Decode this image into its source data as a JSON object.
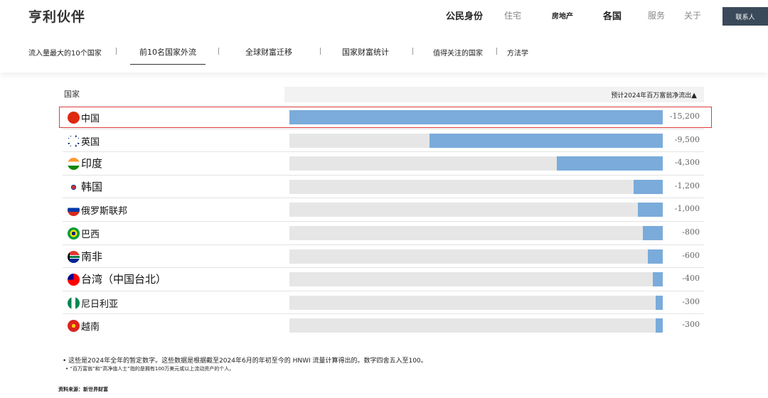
{
  "brand": "亨利伙伴",
  "nav": [
    {
      "label": "公民身份"
    },
    {
      "label": "住宅"
    },
    {
      "label": "房地产"
    },
    {
      "label": "各国"
    },
    {
      "label": "服务"
    },
    {
      "label": "关于"
    }
  ],
  "contact_label": "联系人",
  "subnav": [
    {
      "label": "流入量最大的10个国家"
    },
    {
      "label": "前10名国家外流"
    },
    {
      "label": "全球财富迁移"
    },
    {
      "label": "国家财富统计"
    },
    {
      "label": "值得关注的国家"
    },
    {
      "label": "方法学"
    }
  ],
  "table": {
    "country_header": "国家",
    "metric_header": "预计2024年百万富翁净流出",
    "sort_icon": "▲"
  },
  "chart_data": {
    "type": "bar",
    "orientation": "horizontal",
    "categories": [
      "中国",
      "英国",
      "印度",
      "韩国",
      "俄罗斯联邦",
      "巴西",
      "南非",
      "台湾（中国台北）",
      "尼日利亚",
      "越南"
    ],
    "values": [
      -15200,
      -9500,
      -4300,
      -1200,
      -1000,
      -800,
      -600,
      -400,
      -300,
      -300
    ],
    "value_labels": [
      "-15,200",
      "-9,500",
      "-4,300",
      "-1,200",
      "-1,000",
      "-800",
      "-600",
      "-400",
      "-300",
      "-300"
    ],
    "xlim": [
      -15200,
      0
    ],
    "highlighted_category": "中国",
    "bar_color": "#7aabdb",
    "track_color": "#e6e6e6",
    "highlight_color": "#e23b3b"
  },
  "flags": [
    "cn-flag",
    "uk-flag",
    "in-flag",
    "kr-flag",
    "ru-flag",
    "br-flag",
    "za-flag",
    "tw-flag",
    "ng-flag",
    "vn-flag"
  ],
  "notes": [
    "• 这些是2024年全年的暂定数字。这些数据是根据截至2024年6月的年初至今的 HNWI 流量计算得出的。数字四舍五入至100。",
    "•  “百万富翁”和“高净值人士”指的是拥有100万美元或以上流动资产的个人。"
  ],
  "source": "资料来源：新世界财富"
}
